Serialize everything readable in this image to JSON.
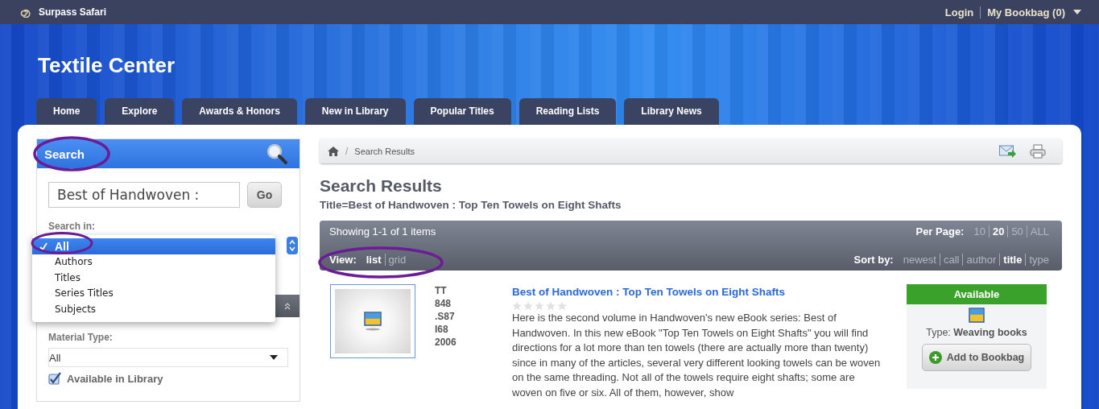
{
  "topbar": {
    "brand": "Surpass Safari",
    "links": [
      "Login",
      "My Bookbag (0)"
    ]
  },
  "site_title": "Textile Center",
  "tabs": [
    "Home",
    "Explore",
    "Awards & Honors",
    "New in Library",
    "Popular Titles",
    "Reading Lists",
    "Library News"
  ],
  "search_panel": {
    "title": "Search",
    "query": "Best of Handwoven :",
    "go": "Go",
    "search_in_label": "Search in:",
    "search_in_options": [
      {
        "label": "All",
        "selected": true
      },
      {
        "label": "Authors",
        "selected": false
      },
      {
        "label": "Titles",
        "selected": false
      },
      {
        "label": "Series Titles",
        "selected": false
      },
      {
        "label": "Subjects",
        "selected": false
      }
    ],
    "material_type_label": "Material Type:",
    "material_type_value": "All",
    "available_checkbox": {
      "label": "Available in Library",
      "checked": true
    }
  },
  "breadcrumb": {
    "separator": "/",
    "current": "Search Results"
  },
  "heading": "Search Results",
  "query_summary": "Title=Best of Handwoven : Top Ten Towels on Eight Shafts",
  "results_bar": {
    "showing": "Showing 1-1 of 1 items",
    "view_label": "View:",
    "views": [
      {
        "label": "list",
        "selected": true
      },
      {
        "label": "grid",
        "selected": false
      }
    ],
    "per_page_label": "Per Page:",
    "per_page": [
      {
        "label": "10",
        "selected": false
      },
      {
        "label": "20",
        "selected": true
      },
      {
        "label": "50",
        "selected": false
      },
      {
        "label": "ALL",
        "selected": false
      }
    ],
    "sort_label": "Sort by:",
    "sort": [
      {
        "label": "newest",
        "selected": false
      },
      {
        "label": "call",
        "selected": false
      },
      {
        "label": "author",
        "selected": false
      },
      {
        "label": "title",
        "selected": true
      },
      {
        "label": "type",
        "selected": false
      }
    ]
  },
  "results": [
    {
      "call_number": [
        "TT",
        "848",
        ".S87",
        "I68",
        "2006"
      ],
      "title": "Best of Handwoven : Top Ten Towels on Eight Shafts",
      "stars": 0,
      "description": "Here is the second volume in Handwoven's new eBook series: Best of Handwoven. In this new eBook \"Top Ten Towels on Eight Shafts\" you will find directions for a lot more than ten towels (there are actually more than twenty) since in many of the articles, several very different looking towels can be woven on the same threading. Not all of the towels require eight shafts; some are woven on five or six. All of them, however, show",
      "availability": "Available",
      "type": "Type: **Weaving books**",
      "add_button": "Add to Bookbag"
    }
  ]
}
